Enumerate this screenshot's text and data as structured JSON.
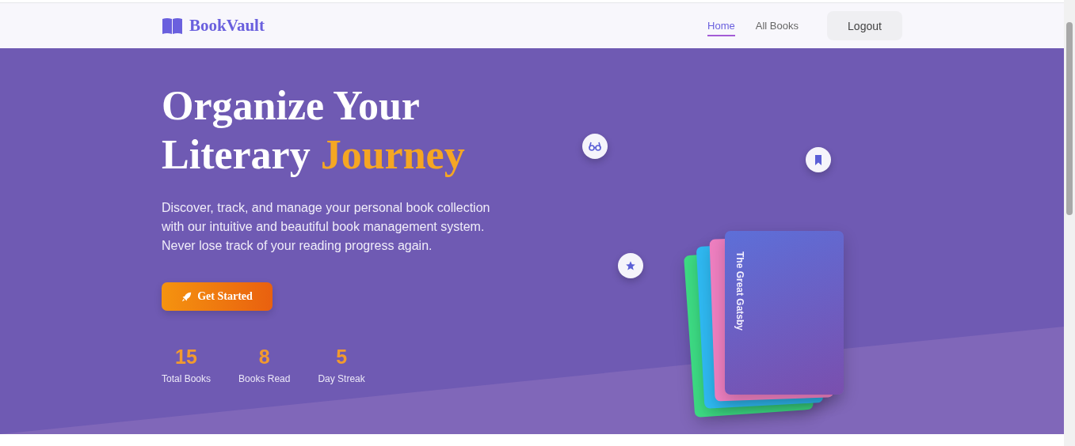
{
  "nav": {
    "brand": "BookVault",
    "links": [
      {
        "label": "Home",
        "selected": true
      },
      {
        "label": "All Books",
        "selected": false
      }
    ],
    "logout": "Logout"
  },
  "hero": {
    "title_lines": [
      [
        {
          "text": "Organize Your",
          "accent": false
        }
      ],
      [
        {
          "text": "Literary",
          "accent": false
        },
        {
          "text": "Journey",
          "accent": true
        }
      ]
    ],
    "description": "Discover, track, and manage your personal book collection with our intuitive and beautiful book management system. Never lose track of your reading progress again.",
    "cta": "Get Started",
    "stats": [
      {
        "value": "15",
        "label": "Total Books"
      },
      {
        "value": "8",
        "label": "Books Read"
      },
      {
        "value": "5",
        "label": "Day Streak"
      }
    ],
    "book_stack": [
      {
        "color": "#3ddc84"
      },
      {
        "color": "#2fb9f2"
      },
      {
        "color": "#ee7fc0"
      }
    ],
    "front_book": {
      "title": "The Great Gatsby"
    }
  }
}
